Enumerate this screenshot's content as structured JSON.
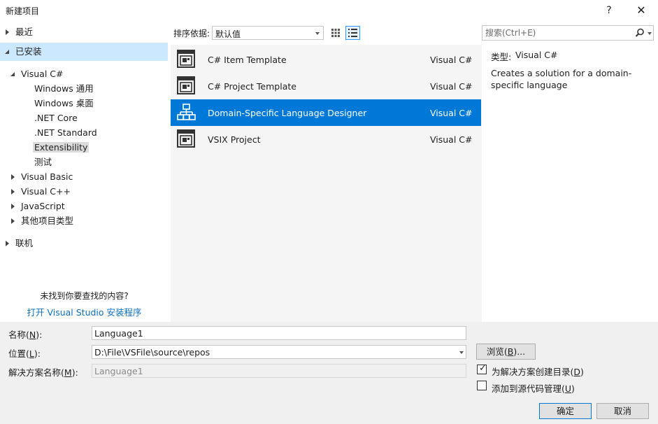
{
  "window": {
    "title": "新建项目",
    "help_glyph": "?",
    "close_glyph": "✕"
  },
  "tree": {
    "recent": "最近",
    "installed": "已安装",
    "visual_csharp": "Visual C#",
    "children": [
      "Windows 通用",
      "Windows 桌面",
      ".NET Core",
      ".NET Standard",
      "Extensibility",
      "测试"
    ],
    "others": [
      "Visual Basic",
      "Visual C++",
      "JavaScript",
      "其他项目类型"
    ],
    "online": "联机",
    "not_found": "未找到你要查找的内容?",
    "installer_link": "打开 Visual Studio 安装程序"
  },
  "toolbar": {
    "sort_label": "排序依据:",
    "sort_value": "默认值"
  },
  "templates": [
    {
      "name": "C# Item Template",
      "lang": "Visual C#",
      "icon": "template-icon",
      "selected": false
    },
    {
      "name": "C# Project Template",
      "lang": "Visual C#",
      "icon": "template-icon",
      "selected": false
    },
    {
      "name": "Domain-Specific Language Designer",
      "lang": "Visual C#",
      "icon": "dsl-hierarchy-icon",
      "selected": true
    },
    {
      "name": "VSIX Project",
      "lang": "Visual C#",
      "icon": "template-icon",
      "selected": false
    }
  ],
  "search": {
    "placeholder": "搜索(Ctrl+E)"
  },
  "details": {
    "type_label": "类型:",
    "type_value": "Visual C#",
    "description": "Creates a solution for a domain-specific language"
  },
  "form": {
    "name_label": "名称(",
    "name_key": "N",
    "name_label_end": "):",
    "name_value": "Language1",
    "location_label": "位置(",
    "location_key": "L",
    "location_label_end": "):",
    "location_value": "D:\\File\\VSFile\\source\\repos",
    "solution_label": "解决方案名称(",
    "solution_key": "M",
    "solution_label_end": "):",
    "solution_value": "Language1",
    "browse_label": "浏览(",
    "browse_key": "B",
    "browse_label_end": ")...",
    "create_dir_label": "为解决方案创建目录(",
    "create_dir_key": "D",
    "create_dir_end": ")",
    "create_dir_checked": true,
    "source_control_label": "添加到源代码管理(",
    "source_control_key": "U",
    "source_control_end": ")",
    "source_control_checked": false,
    "ok_label": "确定",
    "cancel_label": "取消"
  },
  "colors": {
    "selection": "#0078d7",
    "installed_highlight": "#cce8ff",
    "link": "#0e70c0"
  }
}
